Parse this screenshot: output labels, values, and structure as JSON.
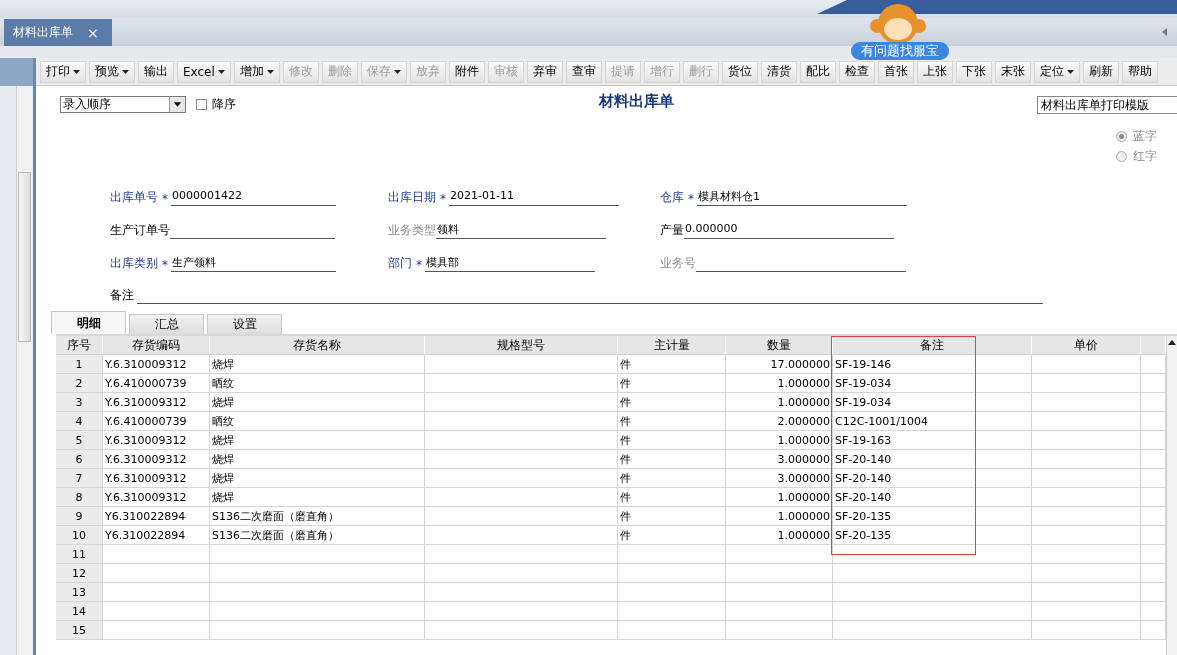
{
  "doc_tab": {
    "label": "材料出库单",
    "close": "×",
    "selected": true
  },
  "help_badge": "有问题找服宝",
  "toolbar": [
    {
      "label": "打印",
      "menu": true,
      "disabled": false
    },
    {
      "label": "预览",
      "menu": true,
      "disabled": false
    },
    {
      "label": "输出",
      "menu": false,
      "disabled": false
    },
    {
      "label": "Excel",
      "menu": true,
      "disabled": false
    },
    {
      "label": "增加",
      "menu": true,
      "disabled": false
    },
    {
      "label": "修改",
      "menu": false,
      "disabled": true
    },
    {
      "label": "删除",
      "menu": false,
      "disabled": true
    },
    {
      "label": "保存",
      "menu": true,
      "disabled": true
    },
    {
      "label": "放弃",
      "menu": false,
      "disabled": true
    },
    {
      "label": "附件",
      "menu": false,
      "disabled": false
    },
    {
      "label": "审核",
      "menu": false,
      "disabled": true
    },
    {
      "label": "弃审",
      "menu": false,
      "disabled": false
    },
    {
      "label": "查审",
      "menu": false,
      "disabled": false
    },
    {
      "label": "提请",
      "menu": false,
      "disabled": true
    },
    {
      "label": "增行",
      "menu": false,
      "disabled": true
    },
    {
      "label": "删行",
      "menu": false,
      "disabled": true
    },
    {
      "label": "货位",
      "menu": false,
      "disabled": false
    },
    {
      "label": "清货",
      "menu": false,
      "disabled": false
    },
    {
      "label": "配比",
      "menu": false,
      "disabled": false
    },
    {
      "label": "检查",
      "menu": false,
      "disabled": false
    },
    {
      "label": "首张",
      "menu": false,
      "disabled": false
    },
    {
      "label": "上张",
      "menu": false,
      "disabled": false
    },
    {
      "label": "下张",
      "menu": false,
      "disabled": false
    },
    {
      "label": "末张",
      "menu": false,
      "disabled": false
    },
    {
      "label": "定位",
      "menu": true,
      "disabled": false
    },
    {
      "label": "刷新",
      "menu": false,
      "disabled": false
    },
    {
      "label": "帮助",
      "menu": false,
      "disabled": false
    }
  ],
  "sort_select": "录入顺序",
  "descending": {
    "label": "降序",
    "checked": false
  },
  "title": "材料出库单",
  "print_template": "材料出库单打印模版",
  "color_mode": [
    {
      "label": "蓝字",
      "selected": true,
      "disabled": true
    },
    {
      "label": "红字",
      "selected": false,
      "disabled": true
    }
  ],
  "fields": [
    {
      "label": "出库单号",
      "value": "0000001422",
      "required": true,
      "disabled": false
    },
    {
      "label": "出库日期",
      "value": "2021-01-11",
      "required": true,
      "disabled": false
    },
    {
      "label": "仓库",
      "value": "模具材料仓1",
      "required": true,
      "disabled": false
    },
    {
      "label": "生产订单号",
      "required": false,
      "disabled": false
    },
    {
      "label": "业务类型",
      "value": "领料",
      "required": false,
      "disabled": true
    },
    {
      "label": "产量",
      "value": "0.000000",
      "required": false,
      "disabled": false
    },
    {
      "label": "出库类别",
      "value": "生产领料",
      "required": true,
      "disabled": false
    },
    {
      "label": "部门",
      "value": "模具部",
      "required": true,
      "disabled": false
    },
    {
      "label": "业务号",
      "required": false,
      "disabled": true
    }
  ],
  "remark": {
    "label": "备注"
  },
  "required_mark": "*",
  "detail_tabs": [
    {
      "label": "明细",
      "selected": true
    },
    {
      "label": "汇总",
      "selected": false
    },
    {
      "label": "设置",
      "selected": false
    }
  ],
  "table": {
    "columns": [
      {
        "label": "序号",
        "highlighted": false
      },
      {
        "label": "存货编码",
        "highlighted": false
      },
      {
        "label": "存货名称",
        "highlighted": false
      },
      {
        "label": "规格型号",
        "highlighted": false
      },
      {
        "label": "主计量",
        "highlighted": false
      },
      {
        "label": "数量",
        "highlighted": false
      },
      {
        "label": "备注",
        "highlighted": true
      },
      {
        "label": "单价",
        "highlighted": false
      }
    ],
    "rows": [
      {
        "no": "1",
        "code": "Y.6.310009312",
        "name": "烧焊",
        "unit": "件",
        "qty": "17.000000",
        "remark": "SF-19-146"
      },
      {
        "no": "2",
        "code": "Y.6.410000739",
        "name": "晒纹",
        "unit": "件",
        "qty": "1.000000",
        "remark": "SF-19-034"
      },
      {
        "no": "3",
        "code": "Y.6.310009312",
        "name": "烧焊",
        "unit": "件",
        "qty": "1.000000",
        "remark": "SF-19-034"
      },
      {
        "no": "4",
        "code": "Y.6.410000739",
        "name": "晒纹",
        "unit": "件",
        "qty": "2.000000",
        "remark": "C12C-1001/1004"
      },
      {
        "no": "5",
        "code": "Y.6.310009312",
        "name": "烧焊",
        "unit": "件",
        "qty": "1.000000",
        "remark": "SF-19-163"
      },
      {
        "no": "6",
        "code": "Y.6.310009312",
        "name": "烧焊",
        "unit": "件",
        "qty": "3.000000",
        "remark": "SF-20-140"
      },
      {
        "no": "7",
        "code": "Y.6.310009312",
        "name": "烧焊",
        "unit": "件",
        "qty": "3.000000",
        "remark": "SF-20-140"
      },
      {
        "no": "8",
        "code": "Y.6.310009312",
        "name": "烧焊",
        "unit": "件",
        "qty": "1.000000",
        "remark": "SF-20-140"
      },
      {
        "no": "9",
        "code": "Y6.310022894",
        "name": "S136二次磨面（磨直角）",
        "unit": "件",
        "qty": "1.000000",
        "remark": "SF-20-135"
      },
      {
        "no": "10",
        "code": "Y6.310022894",
        "name": "S136二次磨面（磨直角）",
        "unit": "件",
        "qty": "1.000000",
        "remark": "SF-20-135"
      },
      {
        "no": "11"
      },
      {
        "no": "12"
      },
      {
        "no": "13"
      },
      {
        "no": "14"
      },
      {
        "no": "15"
      }
    ]
  }
}
